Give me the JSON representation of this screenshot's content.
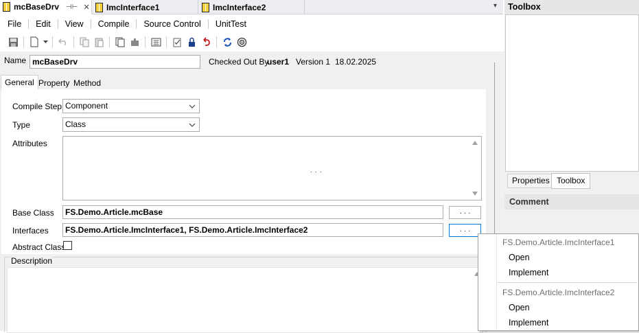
{
  "tabs": [
    {
      "label": "mcBaseDrv",
      "active": true,
      "pin": "⊣⊢",
      "close": "✕"
    },
    {
      "label": "ImcInterface1"
    },
    {
      "label": "ImcInterface2"
    }
  ],
  "tab_dropdown": "▾",
  "menu": [
    "File",
    "Edit",
    "View",
    "Compile",
    "Source Control",
    "UnitTest"
  ],
  "toolbar_icons": [
    "save-icon",
    "new-document-icon",
    "dropdown-arrow-icon",
    "undo-icon",
    "copy-icon",
    "paste-icon",
    "duplicate-icon",
    "plugin-icon",
    "calculator-icon",
    "checklist-icon",
    "lock-user-icon",
    "revert-icon",
    "refresh-icon",
    "target-icon"
  ],
  "header": {
    "name_label": "Name",
    "name_value": "mcBaseDrv",
    "checked_out_label": "Checked Out By",
    "checked_out_user": "user1",
    "version_label": "Version 1",
    "date": "18.02.2025"
  },
  "subtabs": [
    "General",
    "Property",
    "Method"
  ],
  "form": {
    "compile_step_label": "Compile Step",
    "compile_step_value": "Component",
    "type_label": "Type",
    "type_value": "Class",
    "attributes_label": "Attributes",
    "attributes_ellipsis": ". . .",
    "base_class_label": "Base Class",
    "base_class_value": "FS.Demo.Article.mcBase",
    "interfaces_label": "Interfaces",
    "interfaces_value": "FS.Demo.Article.ImcInterface1, FS.Demo.Article.ImcInterface2",
    "abstract_label": "Abstract Class",
    "abstract_checked": false,
    "browse_label": ". . .",
    "description_label": "Description"
  },
  "right_panel": {
    "toolbox_title": "Toolbox",
    "tabs": [
      "Properties",
      "Toolbox"
    ],
    "comment_title": "Comment"
  },
  "context_menu": {
    "groups": [
      {
        "header": "FS.Demo.Article.ImcInterface1",
        "items": [
          "Open",
          "Implement"
        ]
      },
      {
        "header": "FS.Demo.Article.ImcInterface2",
        "items": [
          "Open",
          "Implement"
        ]
      }
    ]
  },
  "colors": {
    "tab_icon": "#f4d03f",
    "focus_border": "#0078d7",
    "panel_bg": "#f0f0f0",
    "tabbar_bg": "#eeeef2"
  }
}
